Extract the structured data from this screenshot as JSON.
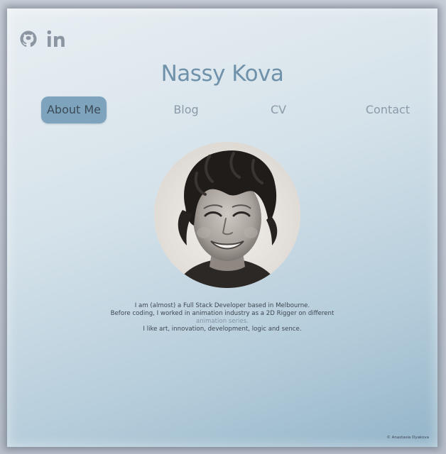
{
  "social": {
    "github_icon": "github-icon",
    "linkedin_label": "in"
  },
  "header": {
    "title": "Nassy Kova"
  },
  "nav": {
    "items": [
      {
        "label": "About Me",
        "active": true
      },
      {
        "label": "Blog",
        "active": false
      },
      {
        "label": "CV",
        "active": false
      },
      {
        "label": "Contact",
        "active": false
      }
    ]
  },
  "bio": {
    "line1": "I am (almost) a Full Stack Developer based in Melbourne.",
    "line2": "Before coding, I worked in animation industry as a 2D Rigger on different",
    "link": "animation series.",
    "line4": "I like art, innovation, development, logic and sence."
  },
  "footer": {
    "copyright": "© Anastasia Dyakova"
  },
  "colors": {
    "accent": "#7ea4bd",
    "title": "#6f92aa",
    "text": "#3e4751"
  }
}
